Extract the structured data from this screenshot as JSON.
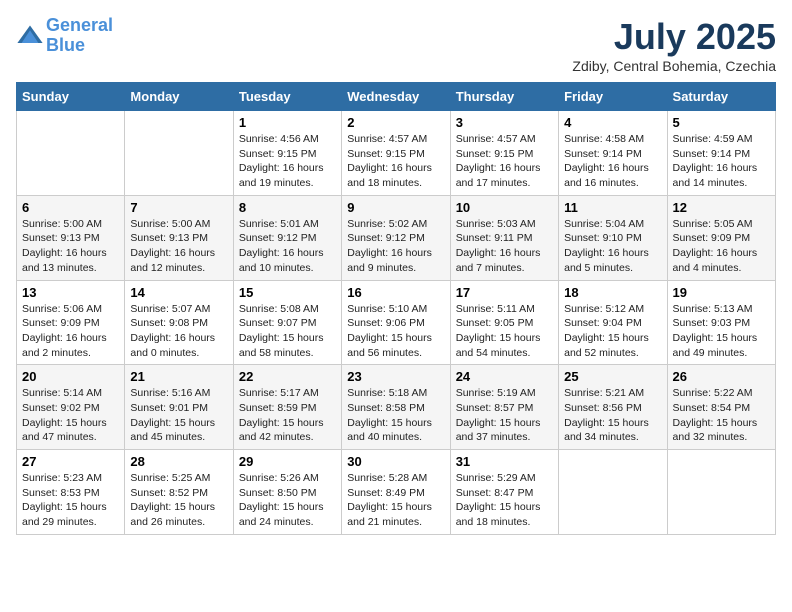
{
  "header": {
    "logo_line1": "General",
    "logo_line2": "Blue",
    "month": "July 2025",
    "location": "Zdiby, Central Bohemia, Czechia"
  },
  "weekdays": [
    "Sunday",
    "Monday",
    "Tuesday",
    "Wednesday",
    "Thursday",
    "Friday",
    "Saturday"
  ],
  "weeks": [
    [
      {
        "day": "",
        "info": ""
      },
      {
        "day": "",
        "info": ""
      },
      {
        "day": "1",
        "info": "Sunrise: 4:56 AM\nSunset: 9:15 PM\nDaylight: 16 hours\nand 19 minutes."
      },
      {
        "day": "2",
        "info": "Sunrise: 4:57 AM\nSunset: 9:15 PM\nDaylight: 16 hours\nand 18 minutes."
      },
      {
        "day": "3",
        "info": "Sunrise: 4:57 AM\nSunset: 9:15 PM\nDaylight: 16 hours\nand 17 minutes."
      },
      {
        "day": "4",
        "info": "Sunrise: 4:58 AM\nSunset: 9:14 PM\nDaylight: 16 hours\nand 16 minutes."
      },
      {
        "day": "5",
        "info": "Sunrise: 4:59 AM\nSunset: 9:14 PM\nDaylight: 16 hours\nand 14 minutes."
      }
    ],
    [
      {
        "day": "6",
        "info": "Sunrise: 5:00 AM\nSunset: 9:13 PM\nDaylight: 16 hours\nand 13 minutes."
      },
      {
        "day": "7",
        "info": "Sunrise: 5:00 AM\nSunset: 9:13 PM\nDaylight: 16 hours\nand 12 minutes."
      },
      {
        "day": "8",
        "info": "Sunrise: 5:01 AM\nSunset: 9:12 PM\nDaylight: 16 hours\nand 10 minutes."
      },
      {
        "day": "9",
        "info": "Sunrise: 5:02 AM\nSunset: 9:12 PM\nDaylight: 16 hours\nand 9 minutes."
      },
      {
        "day": "10",
        "info": "Sunrise: 5:03 AM\nSunset: 9:11 PM\nDaylight: 16 hours\nand 7 minutes."
      },
      {
        "day": "11",
        "info": "Sunrise: 5:04 AM\nSunset: 9:10 PM\nDaylight: 16 hours\nand 5 minutes."
      },
      {
        "day": "12",
        "info": "Sunrise: 5:05 AM\nSunset: 9:09 PM\nDaylight: 16 hours\nand 4 minutes."
      }
    ],
    [
      {
        "day": "13",
        "info": "Sunrise: 5:06 AM\nSunset: 9:09 PM\nDaylight: 16 hours\nand 2 minutes."
      },
      {
        "day": "14",
        "info": "Sunrise: 5:07 AM\nSunset: 9:08 PM\nDaylight: 16 hours\nand 0 minutes."
      },
      {
        "day": "15",
        "info": "Sunrise: 5:08 AM\nSunset: 9:07 PM\nDaylight: 15 hours\nand 58 minutes."
      },
      {
        "day": "16",
        "info": "Sunrise: 5:10 AM\nSunset: 9:06 PM\nDaylight: 15 hours\nand 56 minutes."
      },
      {
        "day": "17",
        "info": "Sunrise: 5:11 AM\nSunset: 9:05 PM\nDaylight: 15 hours\nand 54 minutes."
      },
      {
        "day": "18",
        "info": "Sunrise: 5:12 AM\nSunset: 9:04 PM\nDaylight: 15 hours\nand 52 minutes."
      },
      {
        "day": "19",
        "info": "Sunrise: 5:13 AM\nSunset: 9:03 PM\nDaylight: 15 hours\nand 49 minutes."
      }
    ],
    [
      {
        "day": "20",
        "info": "Sunrise: 5:14 AM\nSunset: 9:02 PM\nDaylight: 15 hours\nand 47 minutes."
      },
      {
        "day": "21",
        "info": "Sunrise: 5:16 AM\nSunset: 9:01 PM\nDaylight: 15 hours\nand 45 minutes."
      },
      {
        "day": "22",
        "info": "Sunrise: 5:17 AM\nSunset: 8:59 PM\nDaylight: 15 hours\nand 42 minutes."
      },
      {
        "day": "23",
        "info": "Sunrise: 5:18 AM\nSunset: 8:58 PM\nDaylight: 15 hours\nand 40 minutes."
      },
      {
        "day": "24",
        "info": "Sunrise: 5:19 AM\nSunset: 8:57 PM\nDaylight: 15 hours\nand 37 minutes."
      },
      {
        "day": "25",
        "info": "Sunrise: 5:21 AM\nSunset: 8:56 PM\nDaylight: 15 hours\nand 34 minutes."
      },
      {
        "day": "26",
        "info": "Sunrise: 5:22 AM\nSunset: 8:54 PM\nDaylight: 15 hours\nand 32 minutes."
      }
    ],
    [
      {
        "day": "27",
        "info": "Sunrise: 5:23 AM\nSunset: 8:53 PM\nDaylight: 15 hours\nand 29 minutes."
      },
      {
        "day": "28",
        "info": "Sunrise: 5:25 AM\nSunset: 8:52 PM\nDaylight: 15 hours\nand 26 minutes."
      },
      {
        "day": "29",
        "info": "Sunrise: 5:26 AM\nSunset: 8:50 PM\nDaylight: 15 hours\nand 24 minutes."
      },
      {
        "day": "30",
        "info": "Sunrise: 5:28 AM\nSunset: 8:49 PM\nDaylight: 15 hours\nand 21 minutes."
      },
      {
        "day": "31",
        "info": "Sunrise: 5:29 AM\nSunset: 8:47 PM\nDaylight: 15 hours\nand 18 minutes."
      },
      {
        "day": "",
        "info": ""
      },
      {
        "day": "",
        "info": ""
      }
    ]
  ]
}
